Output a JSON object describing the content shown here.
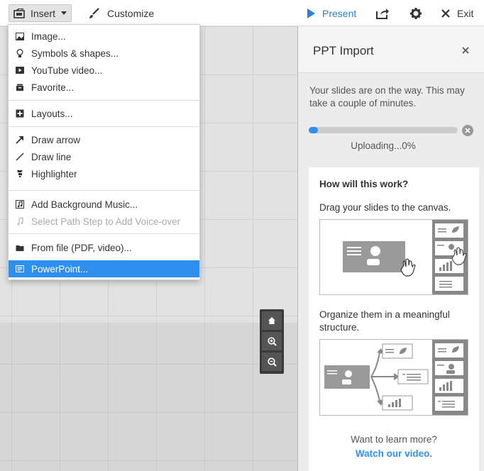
{
  "toolbar": {
    "insert_label": "Insert",
    "customize_label": "Customize",
    "present_label": "Present",
    "exit_label": "Exit"
  },
  "insert_menu": {
    "items": [
      {
        "label": "Image...",
        "icon": "image-icon"
      },
      {
        "label": "Symbols & shapes...",
        "icon": "lightbulb-icon"
      },
      {
        "label": "YouTube video...",
        "icon": "youtube-icon"
      },
      {
        "label": "Favorite...",
        "icon": "favorite-icon"
      },
      {
        "label": "Layouts...",
        "icon": "plus-box-icon"
      },
      {
        "label": "Draw arrow",
        "icon": "arrow-icon"
      },
      {
        "label": "Draw line",
        "icon": "line-icon"
      },
      {
        "label": "Highlighter",
        "icon": "highlighter-icon"
      },
      {
        "label": "Add Background Music...",
        "icon": "music-icon"
      },
      {
        "label": "Select Path Step to Add Voice-over",
        "icon": "voice-icon",
        "disabled": true
      },
      {
        "label": "From file (PDF, video)...",
        "icon": "folder-icon"
      },
      {
        "label": "PowerPoint...",
        "icon": "powerpoint-icon",
        "selected": true
      }
    ]
  },
  "panel": {
    "title": "PPT Import",
    "message": "Your slides are on the way. This may take a couple of minutes.",
    "progress_percent": 0,
    "progress_text": "Uploading...0%",
    "info_heading": "How will this work?",
    "step1": "Drag your slides to the canvas.",
    "step2": "Organize them in a meaningful structure.",
    "learn_more": "Want to learn more?",
    "watch_link": "Watch our video."
  },
  "colors": {
    "accent": "#2e8fef",
    "selected_bg": "#2e8fef",
    "canvas": "#d6d6d6"
  }
}
